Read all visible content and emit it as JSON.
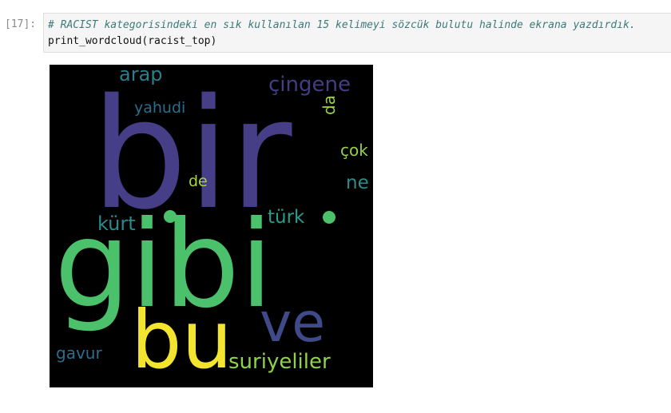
{
  "cell": {
    "prompt": "[17]:",
    "comment": "# RACIST kategorisindeki en sık kullanılan 15 kelimeyi sözcük bulutu halinde ekrana yazdırdık.",
    "code": "print_wordcloud(racist_top)"
  },
  "wordcloud": {
    "background": "#000000",
    "words": {
      "bir": {
        "text": "bir",
        "color": "#463e86"
      },
      "gibi": {
        "text": "gibi",
        "color": "#4cc16b"
      },
      "bu": {
        "text": "bu",
        "color": "#f3e430"
      },
      "ve": {
        "text": "ve",
        "color": "#3f4a88"
      },
      "suriyeliler": {
        "text": "suriyeliler",
        "color": "#8fd348"
      },
      "cingene": {
        "text": "çingene",
        "color": "#433d82"
      },
      "arap": {
        "text": "arap",
        "color": "#2e7d8c"
      },
      "yahudi": {
        "text": "yahudi",
        "color": "#2c6d8c"
      },
      "da": {
        "text": "da",
        "color": "#9ad43e"
      },
      "cok": {
        "text": "çok",
        "color": "#93d246"
      },
      "de": {
        "text": "de",
        "color": "#a6d83a"
      },
      "ne": {
        "text": "ne",
        "color": "#2b8c8a"
      },
      "turk": {
        "text": "türk",
        "color": "#2d9b8a"
      },
      "kurt": {
        "text": "kürt",
        "color": "#2a8a8c"
      },
      "gavur": {
        "text": "gavur",
        "color": "#2f6c8e"
      }
    },
    "dots": {
      "dot1": {
        "color": "#4cc16b"
      },
      "dot2": {
        "color": "#4cc16b"
      }
    }
  }
}
